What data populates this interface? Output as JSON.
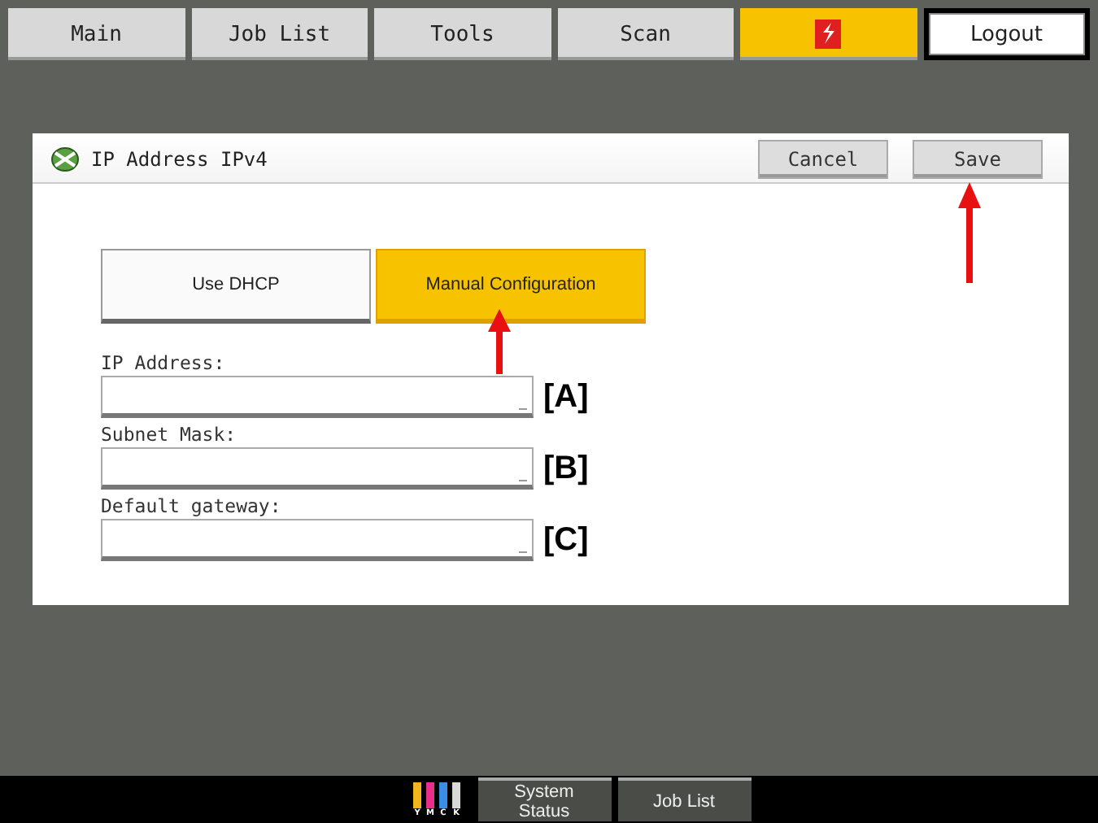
{
  "top_tabs": [
    {
      "kind": "text",
      "label": "Main",
      "selected": false
    },
    {
      "kind": "text",
      "label": "Job List",
      "selected": false
    },
    {
      "kind": "text",
      "label": "Tools",
      "selected": false
    },
    {
      "kind": "text",
      "label": "Scan",
      "selected": false
    },
    {
      "kind": "logo",
      "selected": true
    },
    {
      "kind": "logout",
      "label": "Logout",
      "selected": false
    }
  ],
  "dialog": {
    "title": "IP Address IPv4",
    "buttons": [
      "Cancel",
      "Save"
    ],
    "options": [
      {
        "label": "Use DHCP",
        "selected": false
      },
      {
        "label": "Manual Configuration",
        "selected": true
      }
    ],
    "fields": [
      {
        "label": "IP Address:",
        "callout": "[A]"
      },
      {
        "label": "Subnet Mask:",
        "callout": "[B]"
      },
      {
        "label": "Default gateway:",
        "callout": "[C]"
      }
    ]
  },
  "status_bar": {
    "toner": [
      {
        "label": "Y",
        "color": "#f2b51c"
      },
      {
        "label": "M",
        "color": "#e8308a"
      },
      {
        "label": "C",
        "color": "#3a8ee6"
      },
      {
        "label": "K",
        "color": "#d8d8d8"
      }
    ],
    "buttons": [
      "System Status",
      "Job List"
    ]
  }
}
